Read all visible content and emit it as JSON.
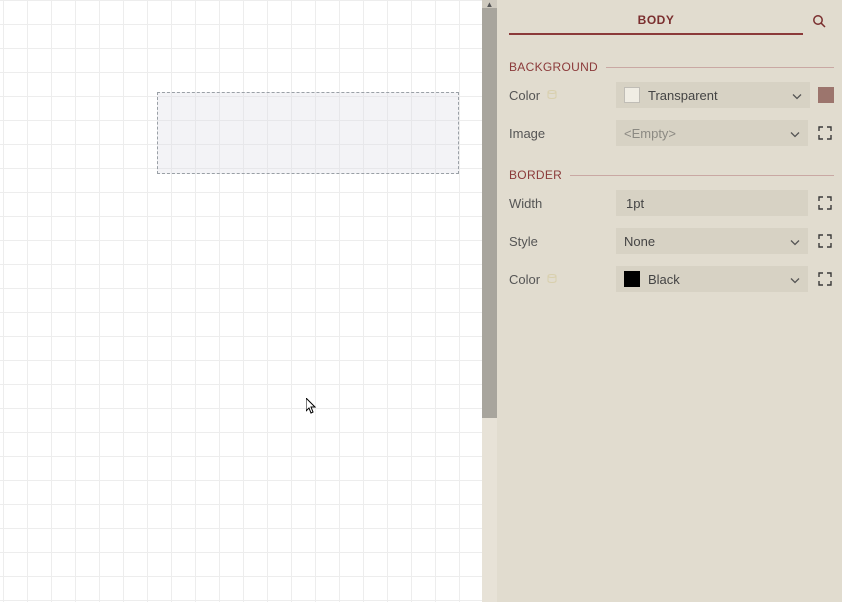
{
  "panel": {
    "tab_label": "BODY",
    "sections": {
      "background": {
        "title": "BACKGROUND",
        "color_label": "Color",
        "color_value": "Transparent",
        "image_label": "Image",
        "image_placeholder": "<Empty>"
      },
      "border": {
        "title": "BORDER",
        "width_label": "Width",
        "width_value": "1pt",
        "style_label": "Style",
        "style_value": "None",
        "color_label": "Color",
        "color_value": "Black"
      }
    }
  },
  "icons": {
    "scroll_up": "▲"
  }
}
